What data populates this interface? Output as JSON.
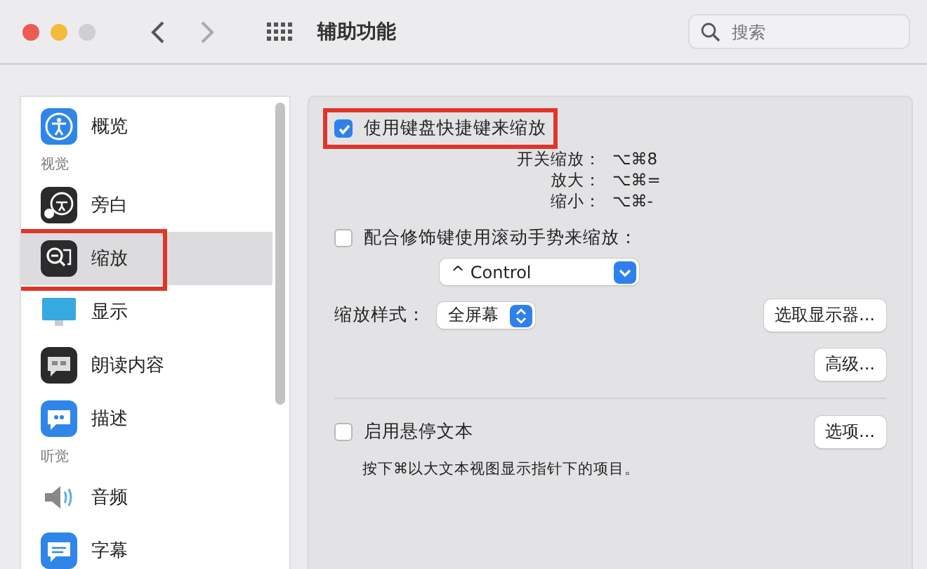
{
  "window": {
    "title": "辅助功能"
  },
  "search": {
    "placeholder": "搜索"
  },
  "sidebar": {
    "items": [
      {
        "kind": "item",
        "label": "概览",
        "selected": false,
        "highlighted": false
      },
      {
        "kind": "header",
        "label": "视觉"
      },
      {
        "kind": "item",
        "label": "旁白",
        "selected": false,
        "highlighted": false
      },
      {
        "kind": "item",
        "label": "缩放",
        "selected": true,
        "highlighted": true
      },
      {
        "kind": "item",
        "label": "显示",
        "selected": false,
        "highlighted": false
      },
      {
        "kind": "item",
        "label": "朗读内容",
        "selected": false,
        "highlighted": false
      },
      {
        "kind": "item",
        "label": "描述",
        "selected": false,
        "highlighted": false
      },
      {
        "kind": "header",
        "label": "听觉"
      },
      {
        "kind": "item",
        "label": "音频",
        "selected": false,
        "highlighted": false
      },
      {
        "kind": "item",
        "label": "字幕",
        "selected": false,
        "highlighted": false
      }
    ]
  },
  "keyboard_zoom": {
    "label": "使用键盘快捷键来缩放",
    "checked": true,
    "highlighted": true,
    "shortcuts": [
      {
        "name": "开关缩放：",
        "keys": "⌥⌘8"
      },
      {
        "name": "放大：",
        "keys": "⌥⌘="
      },
      {
        "name": "缩小：",
        "keys": "⌥⌘-"
      }
    ]
  },
  "scroll_zoom": {
    "label": "配合修饰键使用滚动手势来缩放：",
    "checked": false,
    "modifier": "^ Control"
  },
  "zoom_style": {
    "label": "缩放样式：",
    "value": "全屏幕",
    "button": "选取显示器..."
  },
  "advanced_button": "高级...",
  "hover_text": {
    "label": "启用悬停文本",
    "checked": false,
    "button": "选项...",
    "hint": "按下⌘以大文本视图显示指针下的项目。"
  }
}
